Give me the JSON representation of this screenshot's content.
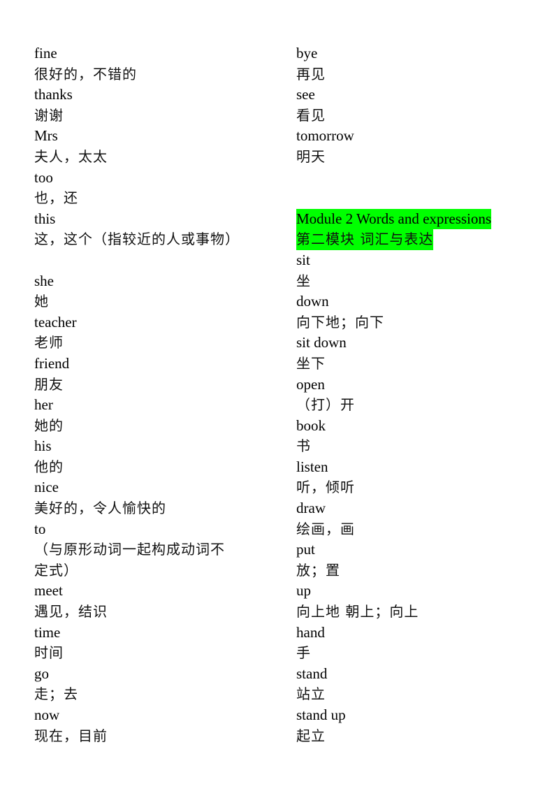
{
  "document": {
    "left_column": [
      {
        "word": "fine",
        "meaning": "很好的，不错的"
      },
      {
        "word": "thanks",
        "meaning": "谢谢"
      },
      {
        "word": "Mrs",
        "meaning": "夫人，太太"
      },
      {
        "word": "too",
        "meaning": "也，还"
      },
      {
        "word": "this",
        "meaning": "这，这个（指较近的人或事物）"
      },
      {
        "word": "she",
        "meaning": "她"
      },
      {
        "word": "teacher",
        "meaning": "老师"
      },
      {
        "word": "friend",
        "meaning": "朋友"
      },
      {
        "word": "her",
        "meaning": "她的"
      },
      {
        "word": "his",
        "meaning": "他的"
      },
      {
        "word": "nice",
        "meaning": "美好的，令人愉快的"
      },
      {
        "word": "to",
        "meaning_line1": "（与原形动词一起构成动词不",
        "meaning_line2": "定式）"
      },
      {
        "word": "meet",
        "meaning": "遇见，结识"
      },
      {
        "word": "time",
        "meaning": "时间"
      },
      {
        "word": "go",
        "meaning": "走；去"
      },
      {
        "word": "now",
        "meaning": "现在，目前"
      }
    ],
    "right_column_top": [
      {
        "word": "bye",
        "meaning": "再见"
      },
      {
        "word": "see",
        "meaning": "看见"
      },
      {
        "word": "tomorrow",
        "meaning": "明天"
      }
    ],
    "module_heading": {
      "english": "Module 2 Words and expressions",
      "chinese": "第二模块 词汇与表达",
      "highlight_color": "#00ff00"
    },
    "right_column_bottom": [
      {
        "word": "sit",
        "meaning": "坐"
      },
      {
        "word": "down",
        "meaning": "向下地；向下"
      },
      {
        "word": "sit down",
        "meaning": "坐下"
      },
      {
        "word": "open",
        "meaning": "（打）开"
      },
      {
        "word": "book",
        "meaning": "书"
      },
      {
        "word": "listen",
        "meaning": "听，倾听"
      },
      {
        "word": "draw",
        "meaning": "绘画，画"
      },
      {
        "word": "put",
        "meaning": "放；置"
      },
      {
        "word": "up",
        "meaning": "向上地 朝上；向上"
      },
      {
        "word": "hand",
        "meaning": "手"
      },
      {
        "word": "stand",
        "meaning": "站立"
      },
      {
        "word": "stand up",
        "meaning": "起立"
      }
    ]
  }
}
